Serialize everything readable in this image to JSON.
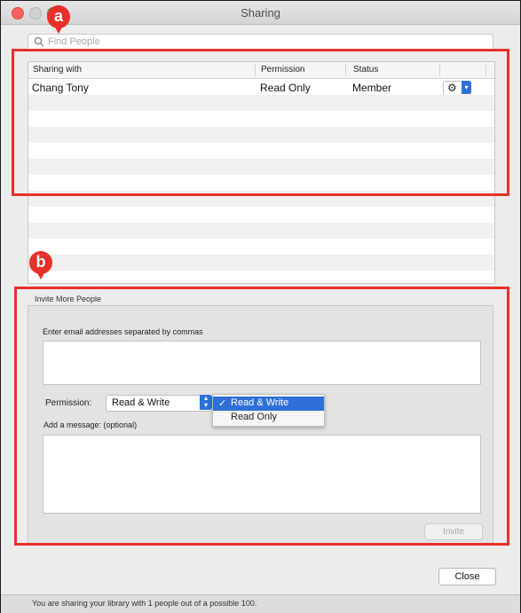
{
  "window": {
    "title": "Sharing",
    "colors": {
      "accent": "#2f6fd8",
      "callout": "#e8302b"
    }
  },
  "search": {
    "placeholder": "Find People",
    "icon": "search-icon"
  },
  "table": {
    "columns": [
      "Sharing with",
      "Permission",
      "Status"
    ],
    "rows": [
      {
        "name": "Chang Tony",
        "permission": "Read Only",
        "status": "Member"
      }
    ]
  },
  "invite": {
    "section_label": "Invite More People",
    "email_label": "Enter email addresses separated by commas",
    "permission_label": "Permission:",
    "permission_value": "Read & Write",
    "permission_options": [
      "Read & Write",
      "Read Only"
    ],
    "message_label": "Add a message: (optional)",
    "invite_button": "Invite"
  },
  "close_button": "Close",
  "status_text": "You are sharing your library with 1 people out of a possible 100.",
  "callouts": {
    "a": "a",
    "b": "b"
  }
}
